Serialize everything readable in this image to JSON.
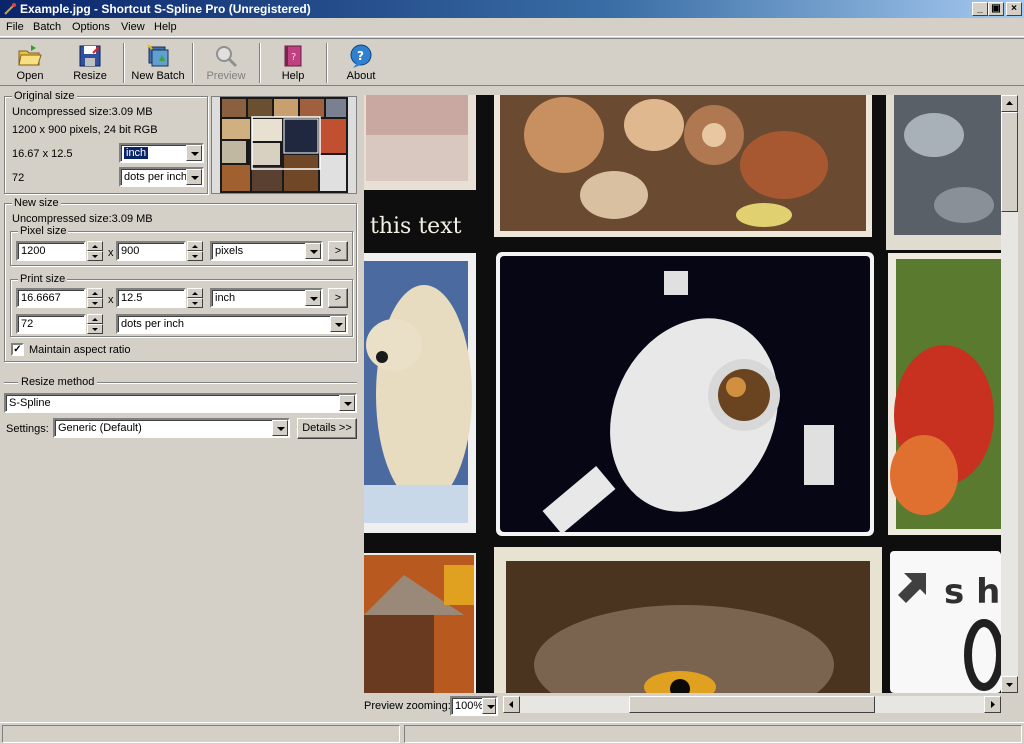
{
  "window": {
    "title": "Example.jpg - Shortcut S-Spline Pro (Unregistered)",
    "minimize": "_",
    "maximize": "▣",
    "close": "×"
  },
  "menu": [
    "File",
    "Batch",
    "Options",
    "View",
    "Help"
  ],
  "toolbar": {
    "open": "Open",
    "resize": "Resize",
    "new_batch": "New Batch",
    "preview": "Preview",
    "help": "Help",
    "about": "About"
  },
  "original": {
    "title": "Original size",
    "uncompressed": "Uncompressed size:3.09 MB",
    "pixels_info": "1200 x 900 pixels, 24 bit RGB",
    "dims": "16.67 x 12.5",
    "unit": "inch",
    "res": "72",
    "res_unit": "dots per inch"
  },
  "newsize": {
    "title": "New size",
    "uncompressed": "Uncompressed size:3.09 MB",
    "pixel_title": "Pixel size",
    "width_px": "1200",
    "height_px": "900",
    "times": "x",
    "pixel_unit": "pixels",
    "print_title": "Print size",
    "width_in": "16.6667",
    "height_in": "12.5",
    "print_unit": "inch",
    "res": "72",
    "res_unit": "dots per inch",
    "go": ">",
    "maintain_aspect": "Maintain aspect ratio",
    "maintain_checked": "✓"
  },
  "method": {
    "title": "Resize method",
    "value": "S-Spline",
    "settings_label": "Settings:",
    "settings_value": "Generic (Default)",
    "details_button": "Details >>"
  },
  "preview": {
    "overlay_text": "this text",
    "logo_text": "s h",
    "zoom_label": "Preview zooming:",
    "zoom_value": "100%"
  }
}
